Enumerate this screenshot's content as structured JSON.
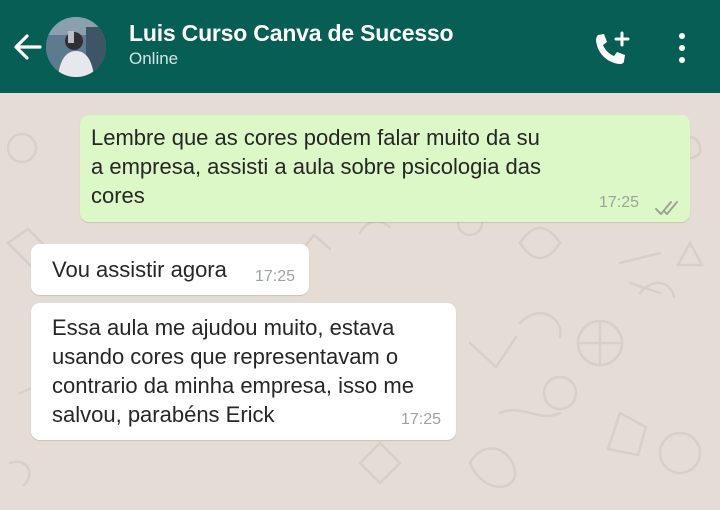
{
  "header": {
    "contact_name": "Luis Curso Canva de Sucesso",
    "status": "Online",
    "back_icon": "arrow-left-icon",
    "call_icon": "add-call-icon",
    "menu_icon": "more-vertical-icon",
    "color": "#075e54"
  },
  "messages": [
    {
      "direction": "outgoing",
      "text": "Lembre que as cores podem falar muito da su\na empresa, assisti a aula sobre psicologia das\ncores",
      "time": "17:25",
      "status_icon": "double-check-icon"
    },
    {
      "direction": "incoming",
      "text": "Vou assistir agora",
      "time": "17:25"
    },
    {
      "direction": "incoming",
      "text": "Essa aula me ajudou muito, estava\nusando cores que representavam o\ncontrario da minha empresa, isso me\nsalvou, parabéns Erick",
      "time": "17:25"
    }
  ],
  "colors": {
    "outgoing": "#dcf8c6",
    "incoming": "#ffffff",
    "wallpaper": "#e5ddd5"
  }
}
